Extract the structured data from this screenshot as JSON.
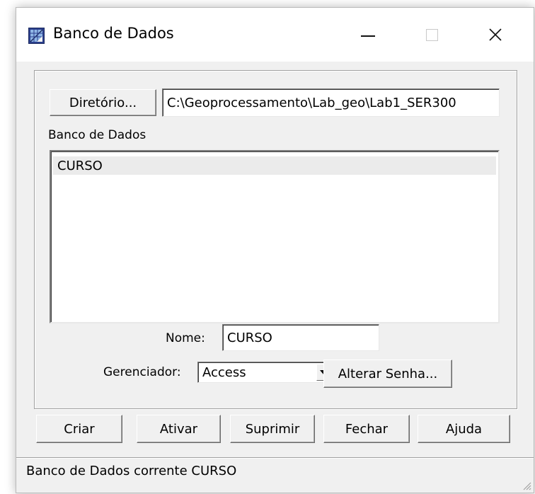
{
  "window": {
    "title": "Banco de Dados",
    "icon": "database-grid-icon",
    "controls": {
      "minimize": "minimize-icon",
      "maximize": "maximize-icon",
      "close": "close-icon"
    }
  },
  "directory": {
    "button_label": "Diretório...",
    "path": "C:\\Geoprocessamento\\Lab_geo\\Lab1_SER300"
  },
  "database_list": {
    "label": "Banco de Dados",
    "items": [
      "CURSO"
    ],
    "selected": "CURSO"
  },
  "name_field": {
    "label": "Nome:",
    "value": "CURSO"
  },
  "manager": {
    "label": "Gerenciador:",
    "selected": "Access",
    "change_password_label": "Alterar Senha..."
  },
  "actions": {
    "create": "Criar",
    "activate": "Ativar",
    "delete": "Suprimir",
    "close": "Fechar",
    "help": "Ajuda"
  },
  "status": {
    "text": "Banco de Dados corrente CURSO"
  },
  "colors": {
    "dialog_bg": "#f0f0f0",
    "titlebar_bg": "#ffffff",
    "selection_bg": "#ebebeb"
  }
}
